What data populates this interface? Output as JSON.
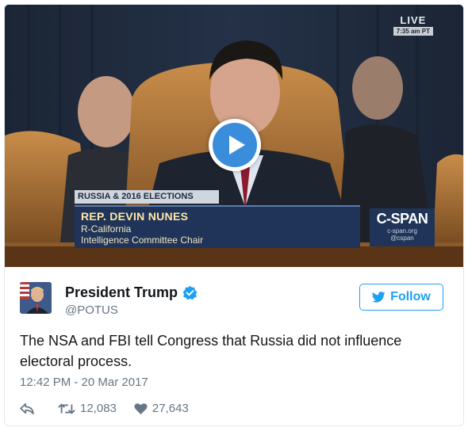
{
  "video": {
    "live_label": "LIVE",
    "live_time": "7:35 am PT",
    "topic": "RUSSIA & 2016 ELECTIONS",
    "name": "REP. DEVIN NUNES",
    "party": "R-California",
    "role": "Intelligence Committee Chair",
    "network_logo": "C-SPAN",
    "network_url": "c-span.org",
    "network_handle": "@cspan",
    "play_icon": "play-icon"
  },
  "tweet": {
    "display_name": "President Trump",
    "handle": "@POTUS",
    "follow_label": "Follow",
    "text": "The NSA and FBI tell Congress that Russia did not influence electoral process.",
    "timestamp": "12:42 PM - 20 Mar 2017",
    "retweets": "12,083",
    "likes": "27,643"
  },
  "colors": {
    "accent": "#1da1f2",
    "play": "#3a8ddb",
    "text": "#14171a",
    "muted": "#657786"
  },
  "icons": [
    "play-icon",
    "verified-badge-icon",
    "twitter-bird-icon",
    "reply-icon",
    "retweet-icon",
    "heart-icon"
  ]
}
